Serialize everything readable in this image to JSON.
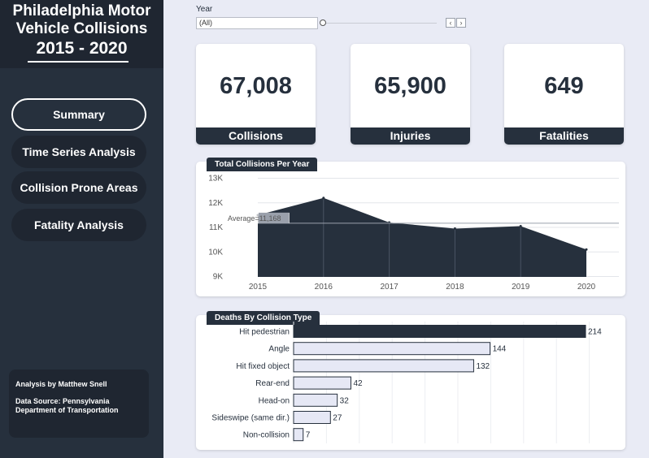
{
  "sidebar": {
    "title_line_1": "Philadelphia Motor",
    "title_line_2": "Vehicle Collisions",
    "title_years": "2015 - 2020",
    "nav": {
      "summary": "Summary",
      "time_series": "Time Series Analysis",
      "collision_prone": "Collision Prone Areas",
      "fatality": "Fatality Analysis"
    },
    "credit_author": "Analysis by Matthew Snell",
    "credit_source": "Data Source: Pennsylvania Department of Transportation"
  },
  "filter": {
    "label": "Year",
    "selected": "(All)",
    "prev_icon": "chevron-left",
    "next_icon": "chevron-right"
  },
  "kpis": {
    "collisions": {
      "value": "67,008",
      "label": "Collisions"
    },
    "injuries": {
      "value": "65,900",
      "label": "Injuries"
    },
    "fatalities": {
      "value": "649",
      "label": "Fatalities"
    }
  },
  "colors": {
    "navy": "#26303d",
    "navy_dark": "#1f2631",
    "background": "#e9ebf5",
    "bar_light": "#e6e8f5"
  },
  "chart_data": [
    {
      "type": "area",
      "title": "Total Collisions Per Year",
      "x": [
        "2015",
        "2016",
        "2017",
        "2018",
        "2019",
        "2020"
      ],
      "values": [
        11500,
        12200,
        11200,
        10950,
        11050,
        10100
      ],
      "ylim": [
        9000,
        13000
      ],
      "y_ticks": [
        9000,
        10000,
        11000,
        12000,
        13000
      ],
      "y_tick_labels": [
        "9K",
        "10K",
        "11K",
        "12K",
        "13K"
      ],
      "reference_line": {
        "label": "Average",
        "display_value": "11,168",
        "value": 11168
      },
      "grid": true
    },
    {
      "type": "bar",
      "orientation": "horizontal",
      "title": "Deaths By Collision Type",
      "categories": [
        "Hit pedestrian",
        "Angle",
        "Hit fixed object",
        "Rear-end",
        "Head-on",
        "Sideswipe (same dir.)",
        "Non-collision"
      ],
      "values": [
        214,
        144,
        132,
        42,
        32,
        27,
        7
      ],
      "xlim": [
        0,
        214
      ],
      "highlight": "Hit pedestrian",
      "grid": true
    }
  ]
}
